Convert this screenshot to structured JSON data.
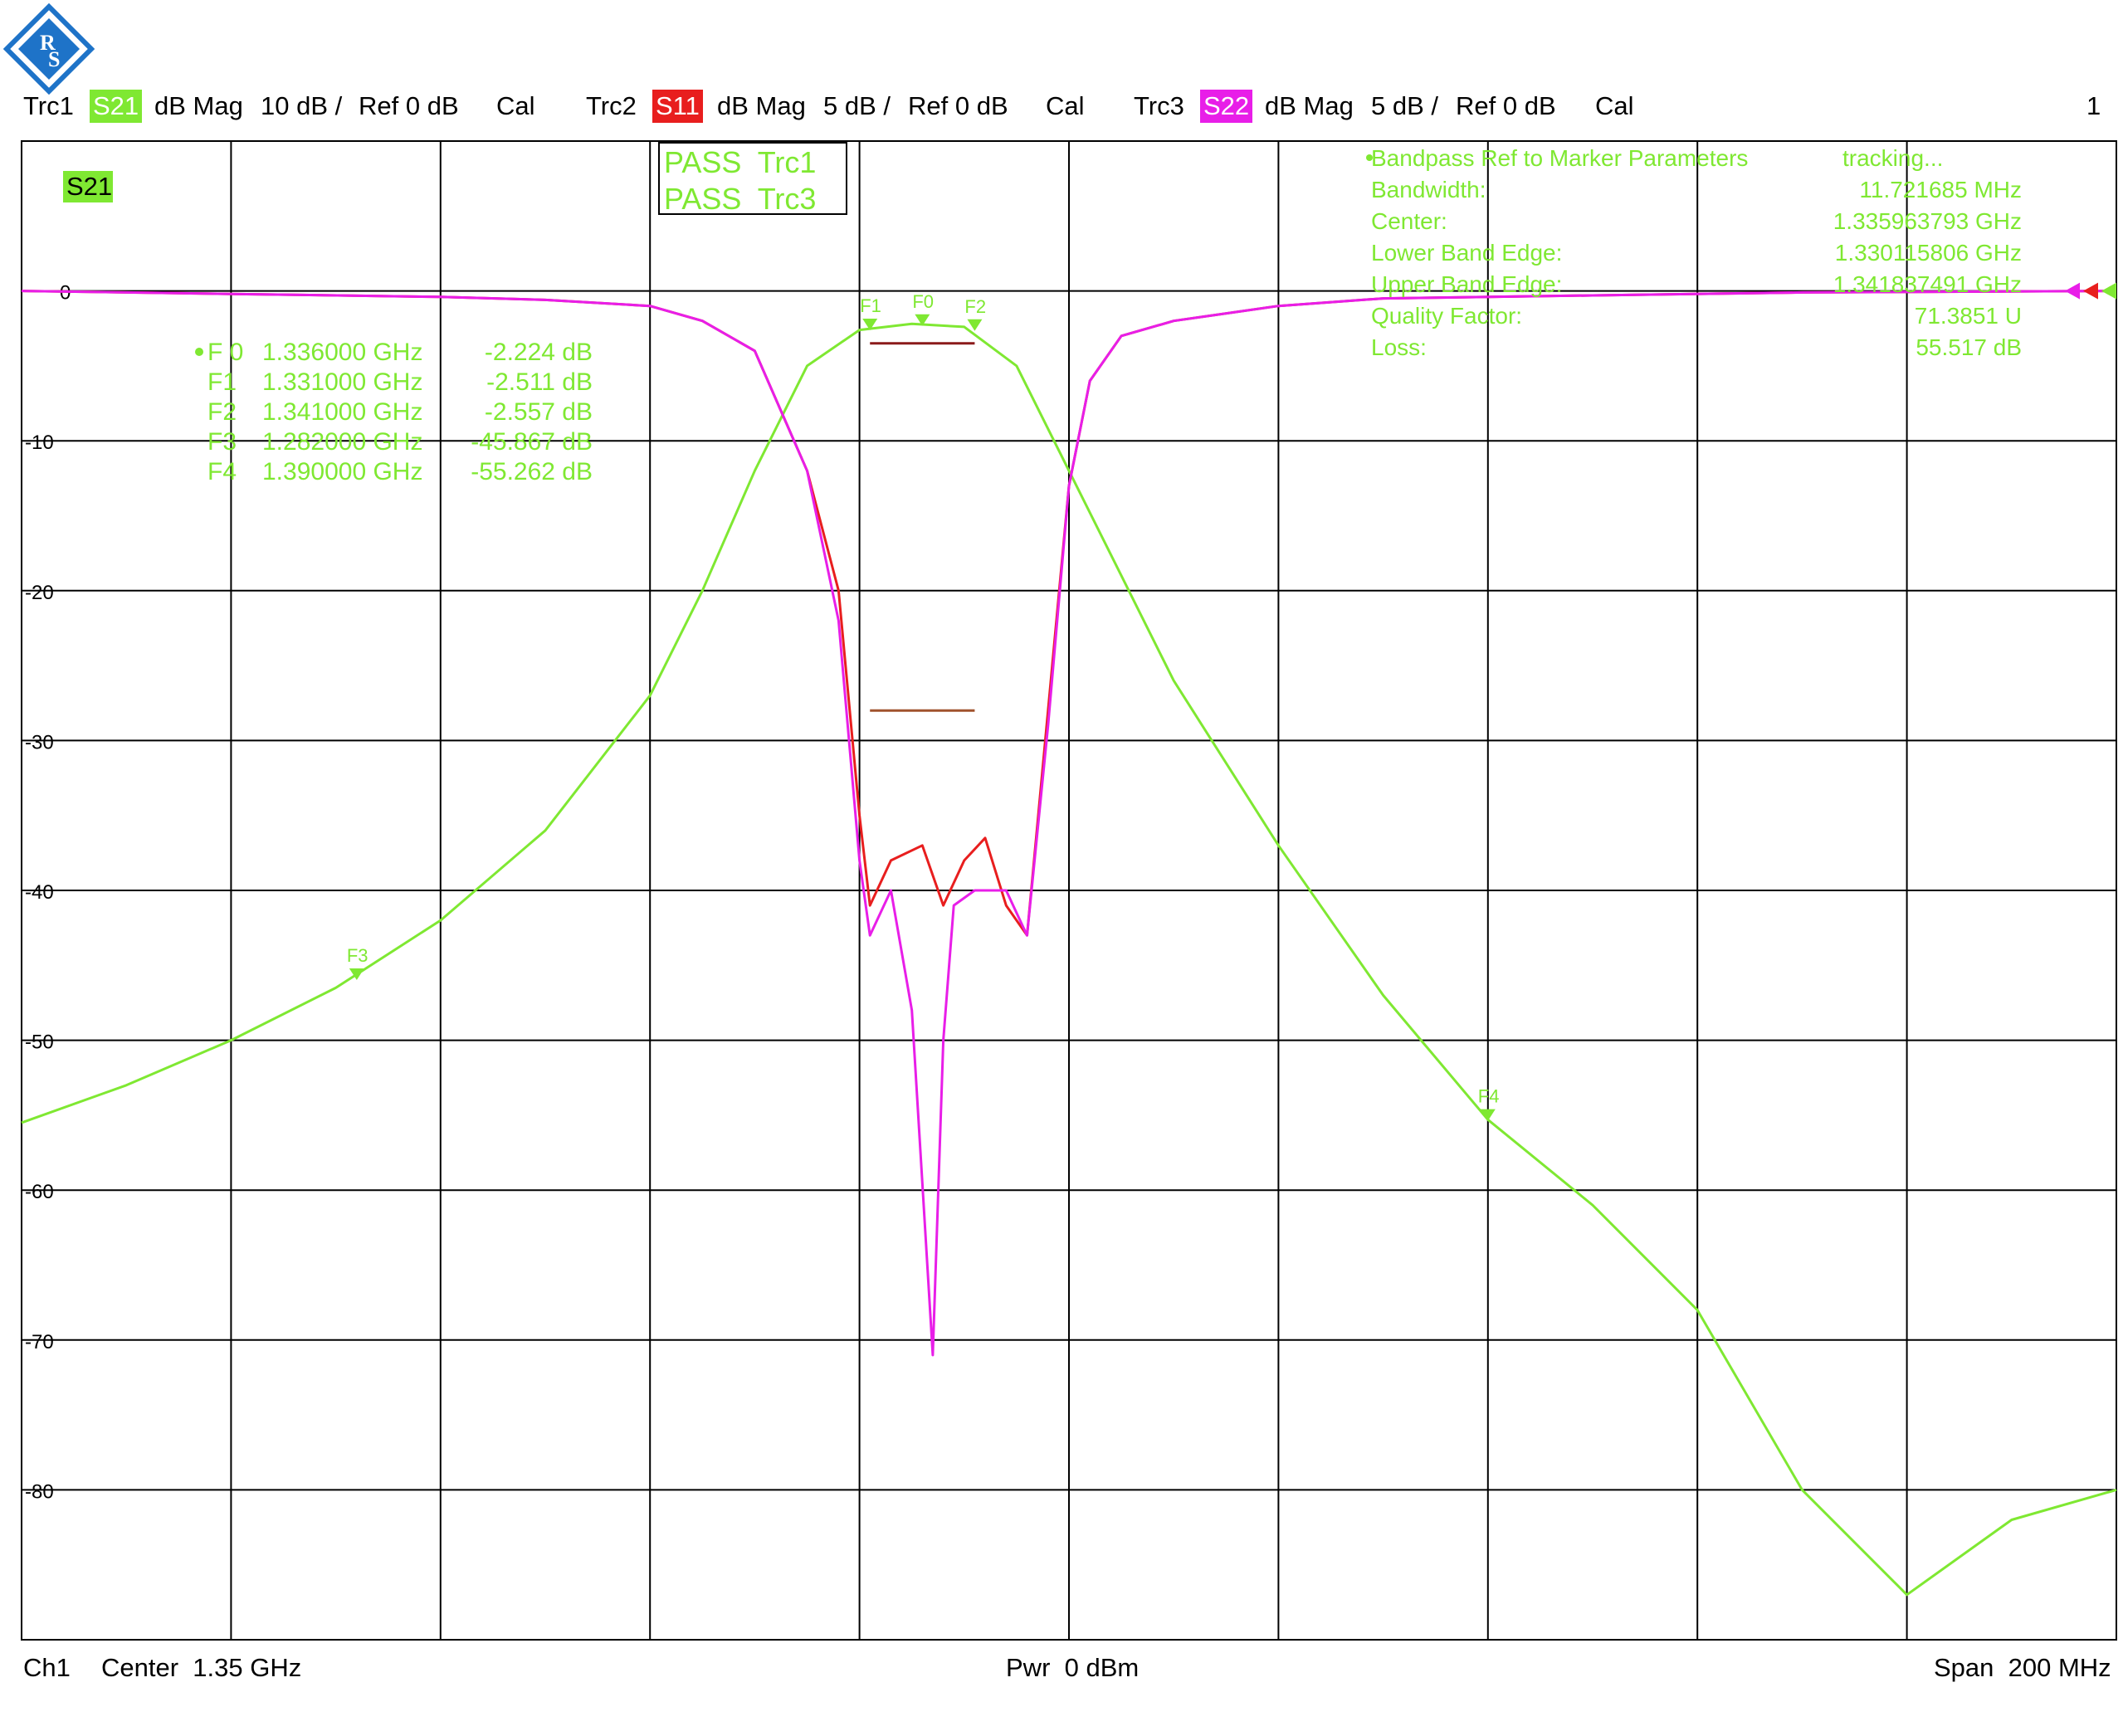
{
  "header": {
    "traces": [
      {
        "id": "Trc1",
        "param": "S21",
        "format": "dB Mag",
        "scale": "10 dB /",
        "ref": "Ref 0 dB",
        "cal": "Cal",
        "color": "#7fe832"
      },
      {
        "id": "Trc2",
        "param": "S11",
        "format": "dB Mag",
        "scale": "5 dB /",
        "ref": "Ref 0 dB",
        "cal": "Cal",
        "color": "#e81e1e"
      },
      {
        "id": "Trc3",
        "param": "S22",
        "format": "dB Mag",
        "scale": "5 dB /",
        "ref": "Ref 0 dB",
        "cal": "Cal",
        "color": "#e81ee8"
      }
    ],
    "channel_number": "1"
  },
  "footer": {
    "channel": "Ch1",
    "center": "Center  1.35 GHz",
    "power": "Pwr  0 dBm",
    "span": "Span  200 MHz"
  },
  "colors": {
    "s21": "#7fe832",
    "s11": "#e81e1e",
    "s22": "#e81ee8",
    "grid": "#000000",
    "limit": "#8b1a1a"
  },
  "chart_data": {
    "type": "line",
    "trace_label": "S21",
    "x_unit": "GHz",
    "xlim": [
      1.25,
      1.45
    ],
    "ylim": [
      -90,
      10
    ],
    "y_ticks": [
      0,
      -10,
      -20,
      -30,
      -40,
      -50,
      -60,
      -70,
      -80
    ],
    "y_tick_labels": [
      "0",
      "-10",
      "-20",
      "-30",
      "-40",
      "-50",
      "-60",
      "-70",
      "-80"
    ],
    "grid": true,
    "limit_test": [
      "PASS  Trc1",
      "PASS  Trc3"
    ],
    "markers": [
      {
        "name": "F0",
        "label": "F 0",
        "freq": "1.336000 GHz",
        "value": "-2.224 dB",
        "x": 1.336,
        "y": -2.224,
        "active": true
      },
      {
        "name": "F1",
        "label": "F1",
        "freq": "1.331000 GHz",
        "value": "-2.511 dB",
        "x": 1.331,
        "y": -2.511
      },
      {
        "name": "F2",
        "label": "F2",
        "freq": "1.341000 GHz",
        "value": "-2.557 dB",
        "x": 1.341,
        "y": -2.557
      },
      {
        "name": "F3",
        "label": "F3",
        "freq": "1.282000 GHz",
        "value": "-45.867 dB",
        "x": 1.282,
        "y": -45.867
      },
      {
        "name": "F4",
        "label": "F4",
        "freq": "1.390000 GHz",
        "value": "-55.262 dB",
        "x": 1.39,
        "y": -55.262
      }
    ],
    "bandpass_params": {
      "title": "Bandpass Ref to Marker Parameters",
      "status": "tracking...",
      "rows": [
        {
          "label": "Bandwidth:",
          "value": "11.721685 MHz"
        },
        {
          "label": "Center:",
          "value": "1.335963793 GHz"
        },
        {
          "label": "Lower Band Edge:",
          "value": "1.330115806 GHz"
        },
        {
          "label": "Upper Band Edge:",
          "value": "1.341837491 GHz"
        },
        {
          "label": "Quality Factor:",
          "value": "71.3851 U"
        },
        {
          "label": "Loss:",
          "value": "55.517 dB"
        }
      ]
    },
    "series": [
      {
        "name": "S21",
        "x": [
          1.25,
          1.26,
          1.27,
          1.28,
          1.29,
          1.3,
          1.31,
          1.315,
          1.32,
          1.325,
          1.33,
          1.335,
          1.34,
          1.345,
          1.35,
          1.355,
          1.36,
          1.37,
          1.38,
          1.39,
          1.4,
          1.41,
          1.42,
          1.43,
          1.44,
          1.45
        ],
        "y": [
          -55.5,
          -53,
          -50,
          -46.5,
          -42,
          -36,
          -27,
          -20,
          -12,
          -5,
          -2.6,
          -2.2,
          -2.4,
          -5,
          -12,
          -19,
          -26,
          -37,
          -47,
          -55.3,
          -61,
          -68,
          -80,
          -87,
          -82,
          -80
        ]
      },
      {
        "name": "S11",
        "x": [
          1.25,
          1.27,
          1.29,
          1.3,
          1.31,
          1.315,
          1.32,
          1.325,
          1.328,
          1.33,
          1.331,
          1.333,
          1.336,
          1.338,
          1.34,
          1.342,
          1.344,
          1.346,
          1.348,
          1.35,
          1.352,
          1.355,
          1.36,
          1.37,
          1.38,
          1.4,
          1.42,
          1.45
        ],
        "y": [
          0,
          -0.2,
          -0.4,
          -0.6,
          -1,
          -2,
          -4,
          -12,
          -20,
          -35,
          -41,
          -38,
          -37,
          -41,
          -38,
          -36.5,
          -41,
          -43,
          -28,
          -13,
          -6,
          -3,
          -2,
          -1,
          -0.5,
          -0.3,
          -0.1,
          0
        ]
      },
      {
        "name": "S22",
        "x": [
          1.25,
          1.27,
          1.29,
          1.3,
          1.31,
          1.315,
          1.32,
          1.325,
          1.328,
          1.33,
          1.331,
          1.333,
          1.335,
          1.337,
          1.338,
          1.339,
          1.341,
          1.344,
          1.346,
          1.348,
          1.35,
          1.352,
          1.355,
          1.36,
          1.37,
          1.38,
          1.4,
          1.42,
          1.45
        ],
        "y": [
          0,
          -0.2,
          -0.4,
          -0.6,
          -1,
          -2,
          -4,
          -12,
          -22,
          -38,
          -43,
          -40,
          -48,
          -71,
          -50,
          -41,
          -40,
          -40,
          -43,
          -29,
          -13,
          -6,
          -3,
          -2,
          -1,
          -0.5,
          -0.3,
          -0.1,
          0
        ]
      }
    ]
  }
}
